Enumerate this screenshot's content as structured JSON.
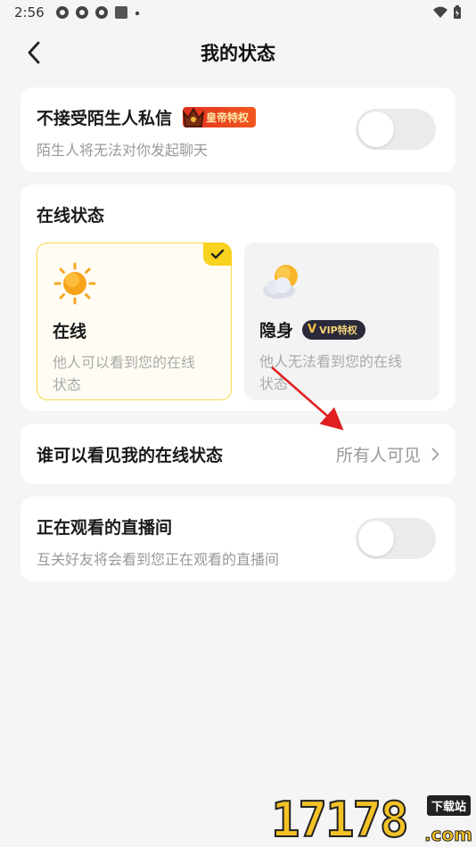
{
  "status_bar": {
    "time": "2:56"
  },
  "header": {
    "title": "我的状态"
  },
  "stranger_messages": {
    "title": "不接受陌生人私信",
    "badge": "皇帝特权",
    "subtitle": "陌生人将无法对你发起聊天",
    "enabled": false
  },
  "online_status": {
    "section_title": "在线状态",
    "options": [
      {
        "label": "在线",
        "desc_line1": "他人可以看到您的在线",
        "desc_line2": "状态",
        "selected": true
      },
      {
        "label": "隐身",
        "badge": "VIP特权",
        "desc_line1": "他人无法看到您的在线",
        "desc_line2": "状态",
        "selected": false
      }
    ]
  },
  "visibility": {
    "label": "谁可以看见我的在线状态",
    "value": "所有人可见"
  },
  "watching_live": {
    "title": "正在观看的直播间",
    "subtitle": "互关好友将会看到您正在观看的直播间",
    "enabled": false
  },
  "watermark": {
    "number": "17178",
    "tag": "下载站",
    "suffix": ".com"
  },
  "colors": {
    "accent": "#f7d21e",
    "toggle_off": "#ebebeb",
    "annotation_arrow": "#e02020"
  }
}
